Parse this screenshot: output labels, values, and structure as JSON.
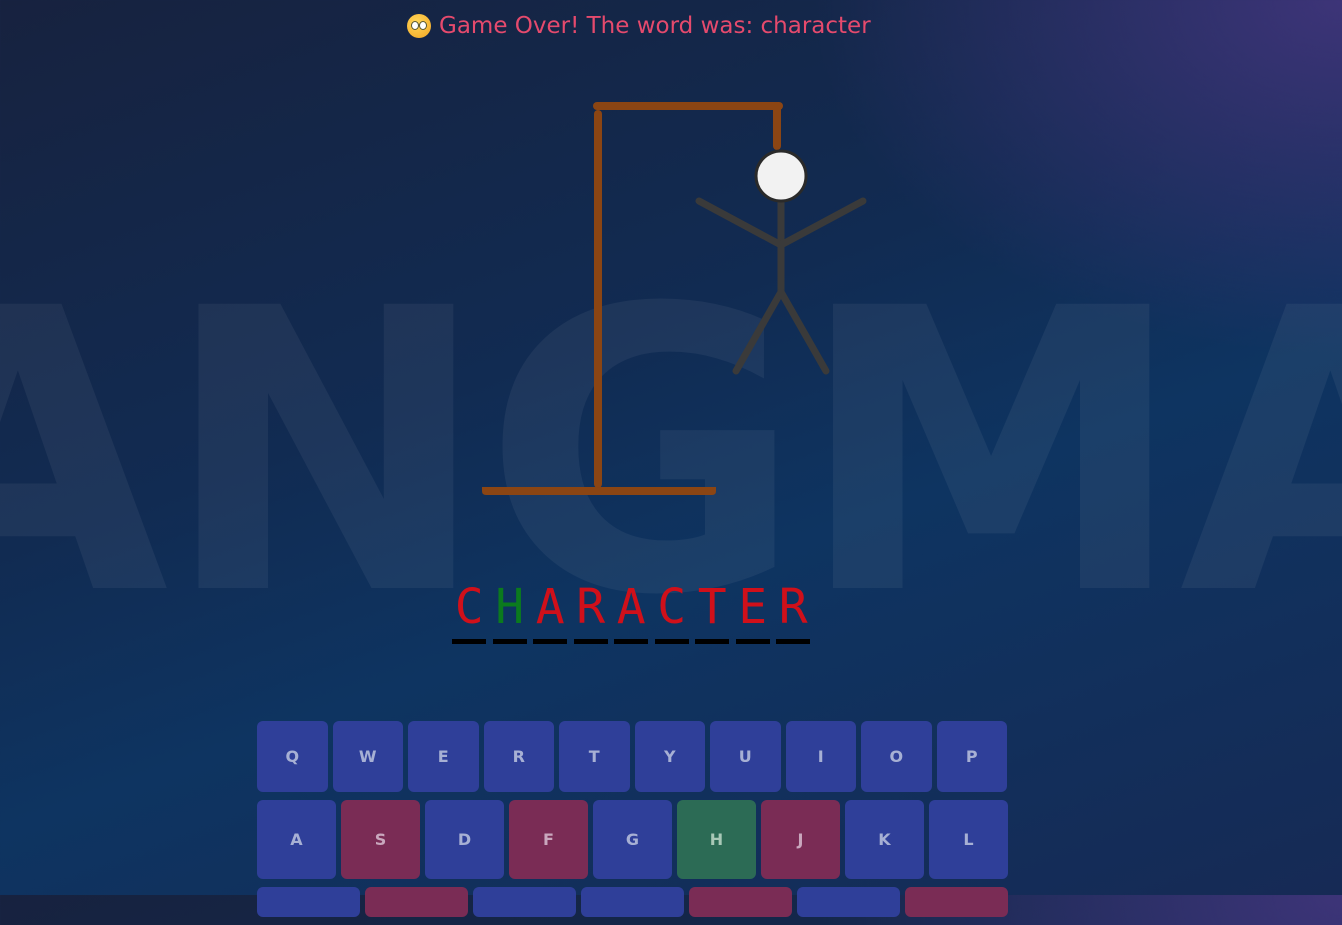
{
  "background_word": "HANGMAN",
  "status": {
    "icon": "flushed-face-icon",
    "message": "Game Over! The word was: character"
  },
  "word": [
    {
      "letter": "C",
      "state": "missed"
    },
    {
      "letter": "H",
      "state": "guessed"
    },
    {
      "letter": "A",
      "state": "missed"
    },
    {
      "letter": "R",
      "state": "missed"
    },
    {
      "letter": "A",
      "state": "missed"
    },
    {
      "letter": "C",
      "state": "missed"
    },
    {
      "letter": "T",
      "state": "missed"
    },
    {
      "letter": "E",
      "state": "missed"
    },
    {
      "letter": "R",
      "state": "missed"
    }
  ],
  "keyboard": {
    "row1": [
      {
        "key": "Q",
        "state": "unused"
      },
      {
        "key": "W",
        "state": "unused"
      },
      {
        "key": "E",
        "state": "unused"
      },
      {
        "key": "R",
        "state": "unused"
      },
      {
        "key": "T",
        "state": "unused"
      },
      {
        "key": "Y",
        "state": "unused"
      },
      {
        "key": "U",
        "state": "unused"
      },
      {
        "key": "I",
        "state": "unused"
      },
      {
        "key": "O",
        "state": "unused"
      },
      {
        "key": "P",
        "state": "unused"
      }
    ],
    "row2": [
      {
        "key": "A",
        "state": "unused"
      },
      {
        "key": "S",
        "state": "wrong"
      },
      {
        "key": "D",
        "state": "unused"
      },
      {
        "key": "F",
        "state": "wrong"
      },
      {
        "key": "G",
        "state": "unused"
      },
      {
        "key": "H",
        "state": "correct"
      },
      {
        "key": "J",
        "state": "wrong"
      },
      {
        "key": "K",
        "state": "unused"
      },
      {
        "key": "L",
        "state": "unused"
      }
    ],
    "row3_states": [
      "unused",
      "wrong",
      "unused",
      "unused",
      "wrong",
      "unused",
      "wrong"
    ]
  },
  "colors": {
    "missed_letter": "#d0101a",
    "guessed_letter": "#0b7a1e",
    "status_text": "#e54a6d",
    "gallows_wood": "#8b4513",
    "key_unused": "#2f3f99",
    "key_wrong": "#7a2c55",
    "key_correct": "#2c6b55"
  }
}
